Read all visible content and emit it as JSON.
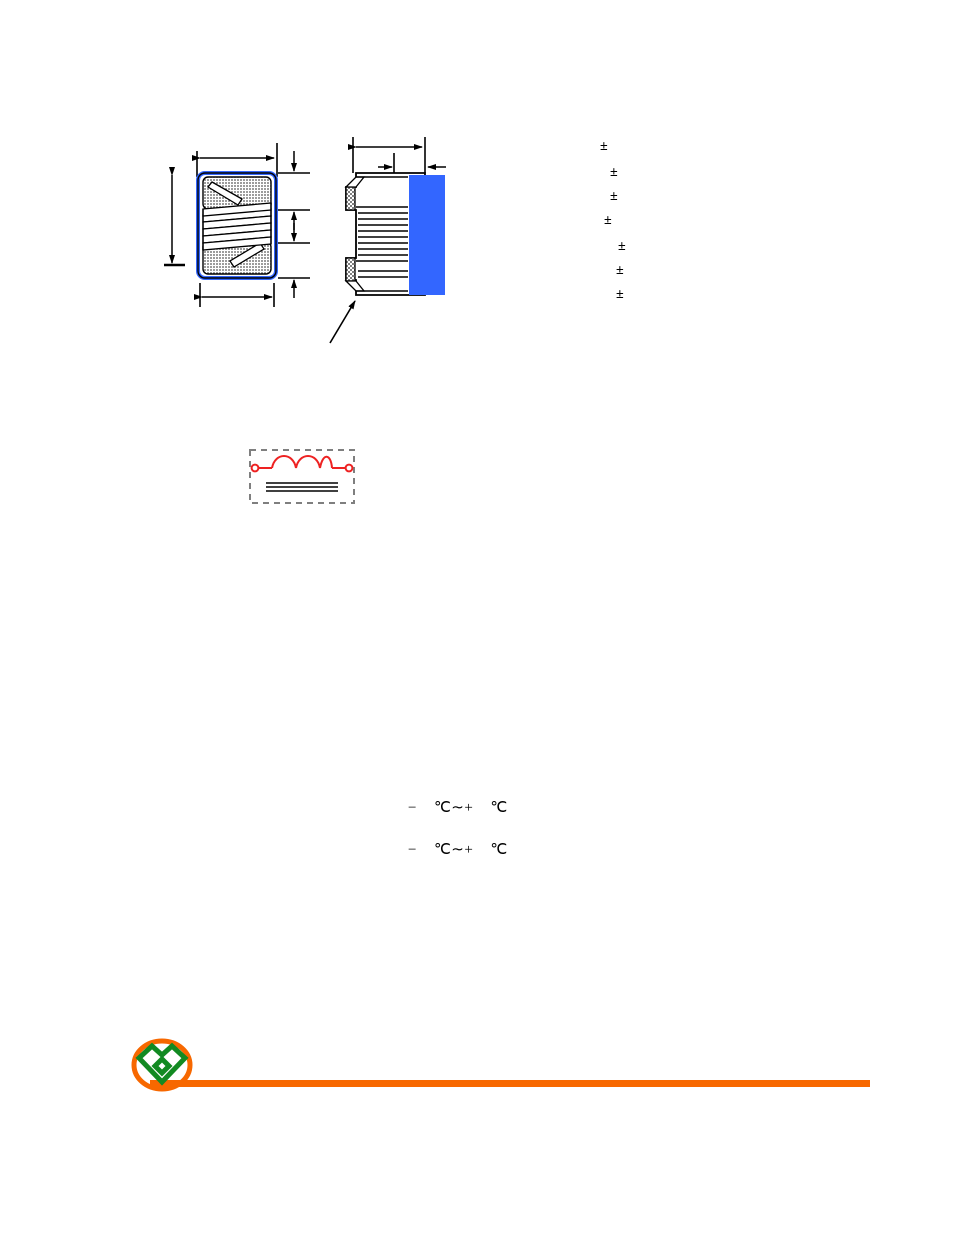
{
  "document": {
    "type": "component-datasheet-page",
    "page_background": "#ffffff"
  },
  "colors": {
    "terminal_blue": "#3366ff",
    "core_outline_black": "#000000",
    "schematic_red": "#ee2222",
    "schematic_dash_gray": "#999999",
    "logo_orange": "#f76800",
    "logo_green": "#128a22",
    "footer_rule_orange": "#f76800"
  },
  "drawing": {
    "name": "chip-inductor-outline-drawing",
    "front_view": {
      "name": "front-view",
      "caption": "",
      "features": [
        "ferrite-core-body",
        "wire-winding-coil",
        "blue-terminal-edge",
        "hatched-end-caps"
      ]
    },
    "side_view": {
      "name": "side-view",
      "caption": "",
      "features": [
        "stacked-winding-lines",
        "blue-terminal-block",
        "terminal-leader-arrow"
      ]
    },
    "dimension_arrows": [
      {
        "name": "width-dimension-top",
        "orientation": "horizontal",
        "label": ""
      },
      {
        "name": "height-dimension-left",
        "orientation": "vertical",
        "label": ""
      },
      {
        "name": "bottom-width-dimension",
        "orientation": "horizontal",
        "label": ""
      },
      {
        "name": "termination-gap-upper",
        "orientation": "vertical",
        "label": ""
      },
      {
        "name": "termination-gap-lower",
        "orientation": "vertical",
        "label": ""
      },
      {
        "name": "depth-dimension-top",
        "orientation": "horizontal",
        "label": ""
      },
      {
        "name": "terminal-thickness-dimension",
        "orientation": "horizontal",
        "label": ""
      },
      {
        "name": "terminal-band-dimension",
        "orientation": "horizontal",
        "label": ""
      }
    ],
    "leader_label": ""
  },
  "tolerances": {
    "name": "dimension-tolerance-column",
    "rows": [
      {
        "indent": 0,
        "text": "±"
      },
      {
        "indent": 10,
        "text": "±"
      },
      {
        "indent": 10,
        "text": "±"
      },
      {
        "indent": 4,
        "text": "±"
      },
      {
        "indent": 14,
        "text": "±"
      },
      {
        "indent": 12,
        "text": "±"
      },
      {
        "indent": 12,
        "text": "±"
      }
    ]
  },
  "schematic": {
    "name": "equivalent-circuit-schematic",
    "caption": "",
    "symbol": "inductor-with-core",
    "coil_humps": 3,
    "core_lines": 3,
    "terminals": 2
  },
  "specs": {
    "temperature_rows": [
      {
        "name": "operating-temperature-range",
        "text": "−    ℃∼+    ℃"
      },
      {
        "name": "storage-temperature-range",
        "text": "−    ℃∼+    ℃"
      }
    ]
  },
  "footer": {
    "name": "page-footer",
    "logo_name": "company-logo",
    "logo_alt": "interlocking-diamond-heart-logo",
    "rule_name": "footer-divider-rule",
    "text": ""
  }
}
